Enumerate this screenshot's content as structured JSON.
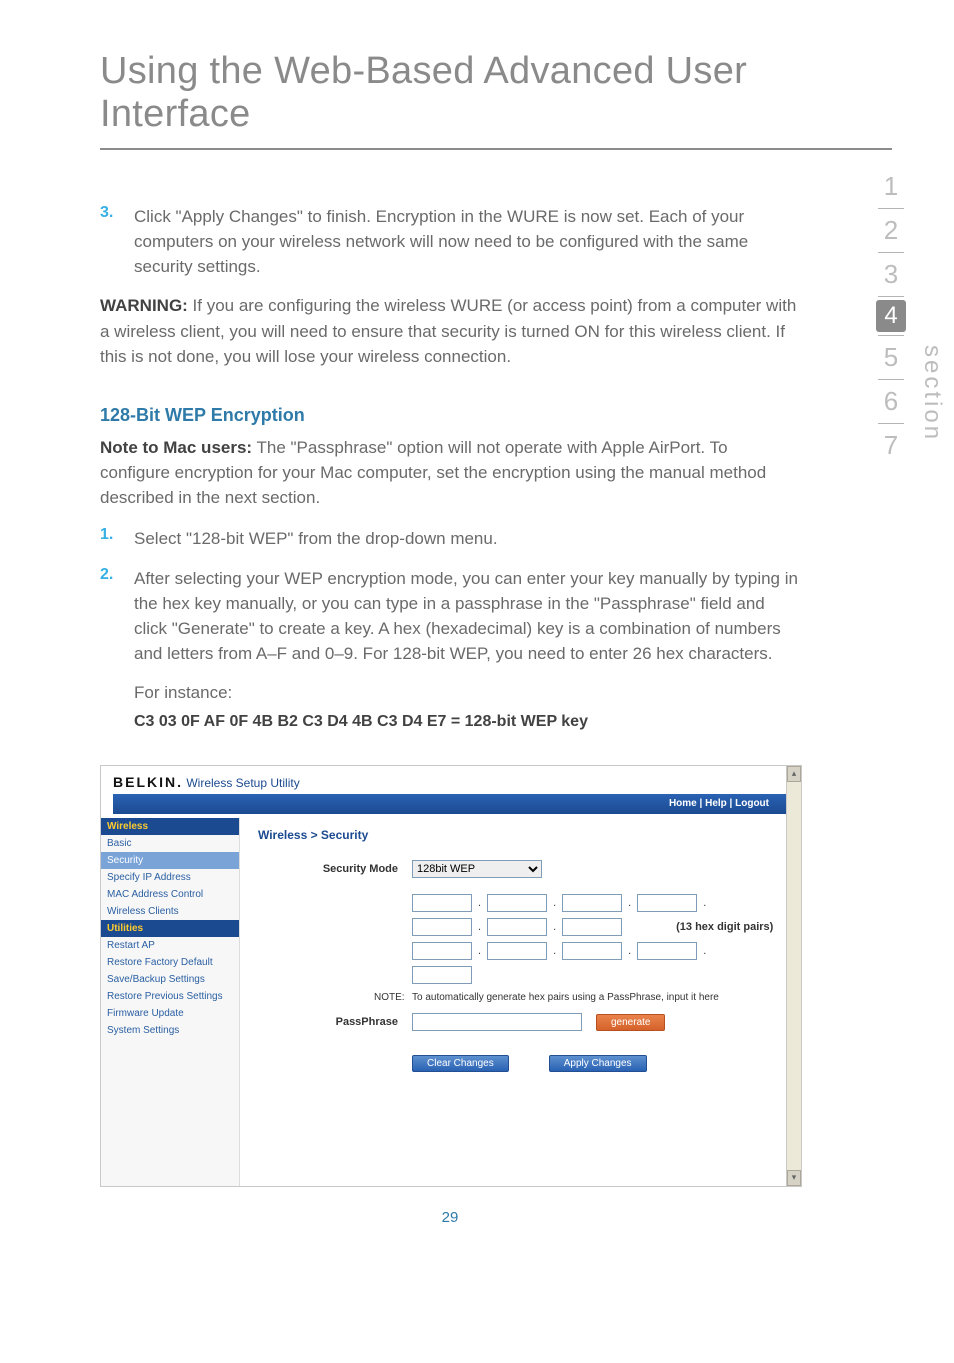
{
  "page_title": "Using the Web-Based Advanced User Interface",
  "section_label": "section",
  "section_nav": [
    "1",
    "2",
    "3",
    "4",
    "5",
    "6",
    "7"
  ],
  "active_section": "4",
  "page_number": "29",
  "step3_num": "3.",
  "step3": "Click \"Apply Changes\" to finish. Encryption in the WURE is now set. Each of your computers on your wireless network will now need to be configured with the same security settings.",
  "warning_label": "WARNING:",
  "warning": " If you are configuring the wireless WURE (or access point) from a computer with a wireless client, you will need to ensure that security is turned ON for this wireless client. If this is not done, you will lose your wireless connection.",
  "subhead": "128-Bit WEP Encryption",
  "mac_note_label": "Note to Mac users:",
  "mac_note": " The \"Passphrase\" option will not operate with Apple AirPort. To configure encryption for your Mac computer, set the encryption using the manual method described in the next section.",
  "step1_num": "1.",
  "step1": "Select \"128-bit WEP\" from the drop-down menu.",
  "step2_num": "2.",
  "step2": "After selecting your WEP encryption mode, you can enter your key manually by typing in the hex key manually, or you can type in a passphrase in the \"Passphrase\" field and click \"Generate\" to create a key. A hex (hexadecimal) key is a combination of numbers and letters from A–F and 0–9. For 128-bit WEP, you need to enter 26 hex characters.",
  "for_instance": "For instance:",
  "hex_example": "C3 03 0F AF 0F 4B B2 C3 D4 4B C3 D4 E7 = 128-bit WEP key",
  "shot": {
    "brand": "BELKIN.",
    "brand_sub": " Wireless Setup Utility",
    "toplinks": "Home | Help | Logout",
    "sidebar": {
      "g1_head": "Wireless",
      "g1_items": [
        "Basic",
        "Security",
        "Specify IP Address",
        "MAC Address Control",
        "Wireless Clients"
      ],
      "active_item": "Security",
      "g2_head": "Utilities",
      "g2_items": [
        "Restart AP",
        "Restore Factory Default",
        "Save/Backup Settings",
        "Restore Previous Settings",
        "Firmware Update",
        "System Settings"
      ]
    },
    "breadcrumb": "Wireless > Security",
    "sec_mode_label": "Security Mode",
    "sec_mode_value": "128bit WEP",
    "hex_count": "(13 hex digit pairs)",
    "note_label": "NOTE:",
    "note_text": "To automatically generate hex pairs using a PassPhrase, input it here",
    "pass_label": "PassPhrase",
    "generate": "generate",
    "clear": "Clear Changes",
    "apply": "Apply Changes"
  }
}
